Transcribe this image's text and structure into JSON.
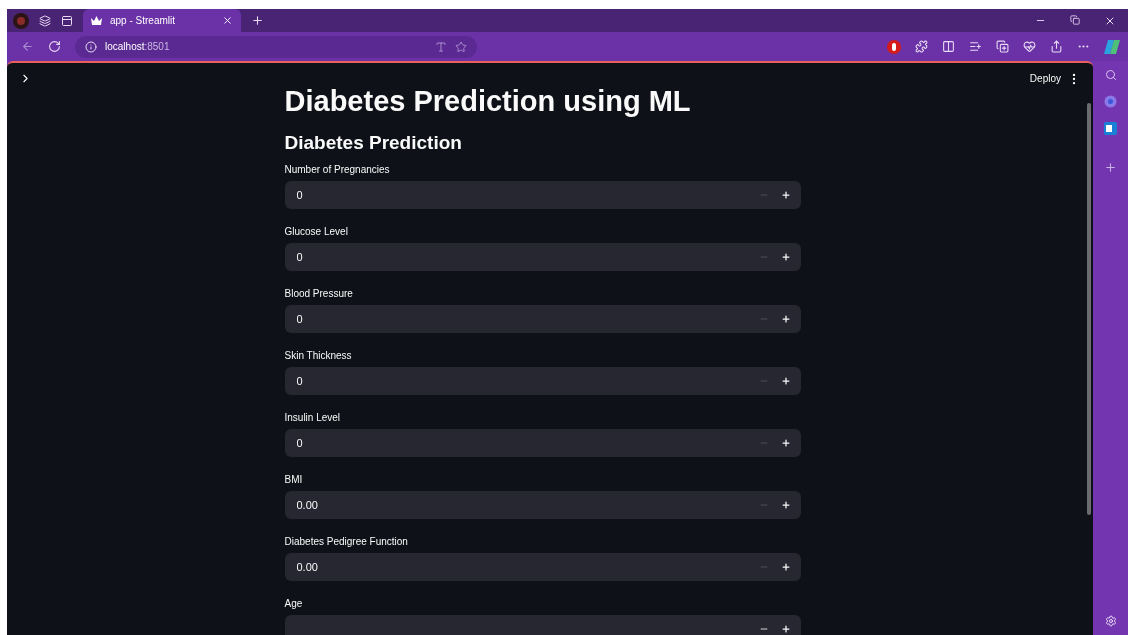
{
  "browser": {
    "tab": {
      "title": "app - Streamlit",
      "selected": true
    },
    "address": {
      "host": "localhost",
      "port": ":8501"
    }
  },
  "app": {
    "deploy": "Deploy",
    "title": "Diabetes Prediction using ML",
    "subheader": "Diabetes Prediction",
    "fields": [
      {
        "label": "Number of Pregnancies",
        "value": "0",
        "minus_disabled": true
      },
      {
        "label": "Glucose Level",
        "value": "0",
        "minus_disabled": true
      },
      {
        "label": "Blood Pressure",
        "value": "0",
        "minus_disabled": true
      },
      {
        "label": "Skin Thickness",
        "value": "0",
        "minus_disabled": true
      },
      {
        "label": "Insulin Level",
        "value": "0",
        "minus_disabled": true
      },
      {
        "label": "BMI",
        "value": "0.00",
        "minus_disabled": true
      },
      {
        "label": "Diabetes Pedigree Function",
        "value": "0.00",
        "minus_disabled": true
      },
      {
        "label": "Age"
      }
    ]
  }
}
